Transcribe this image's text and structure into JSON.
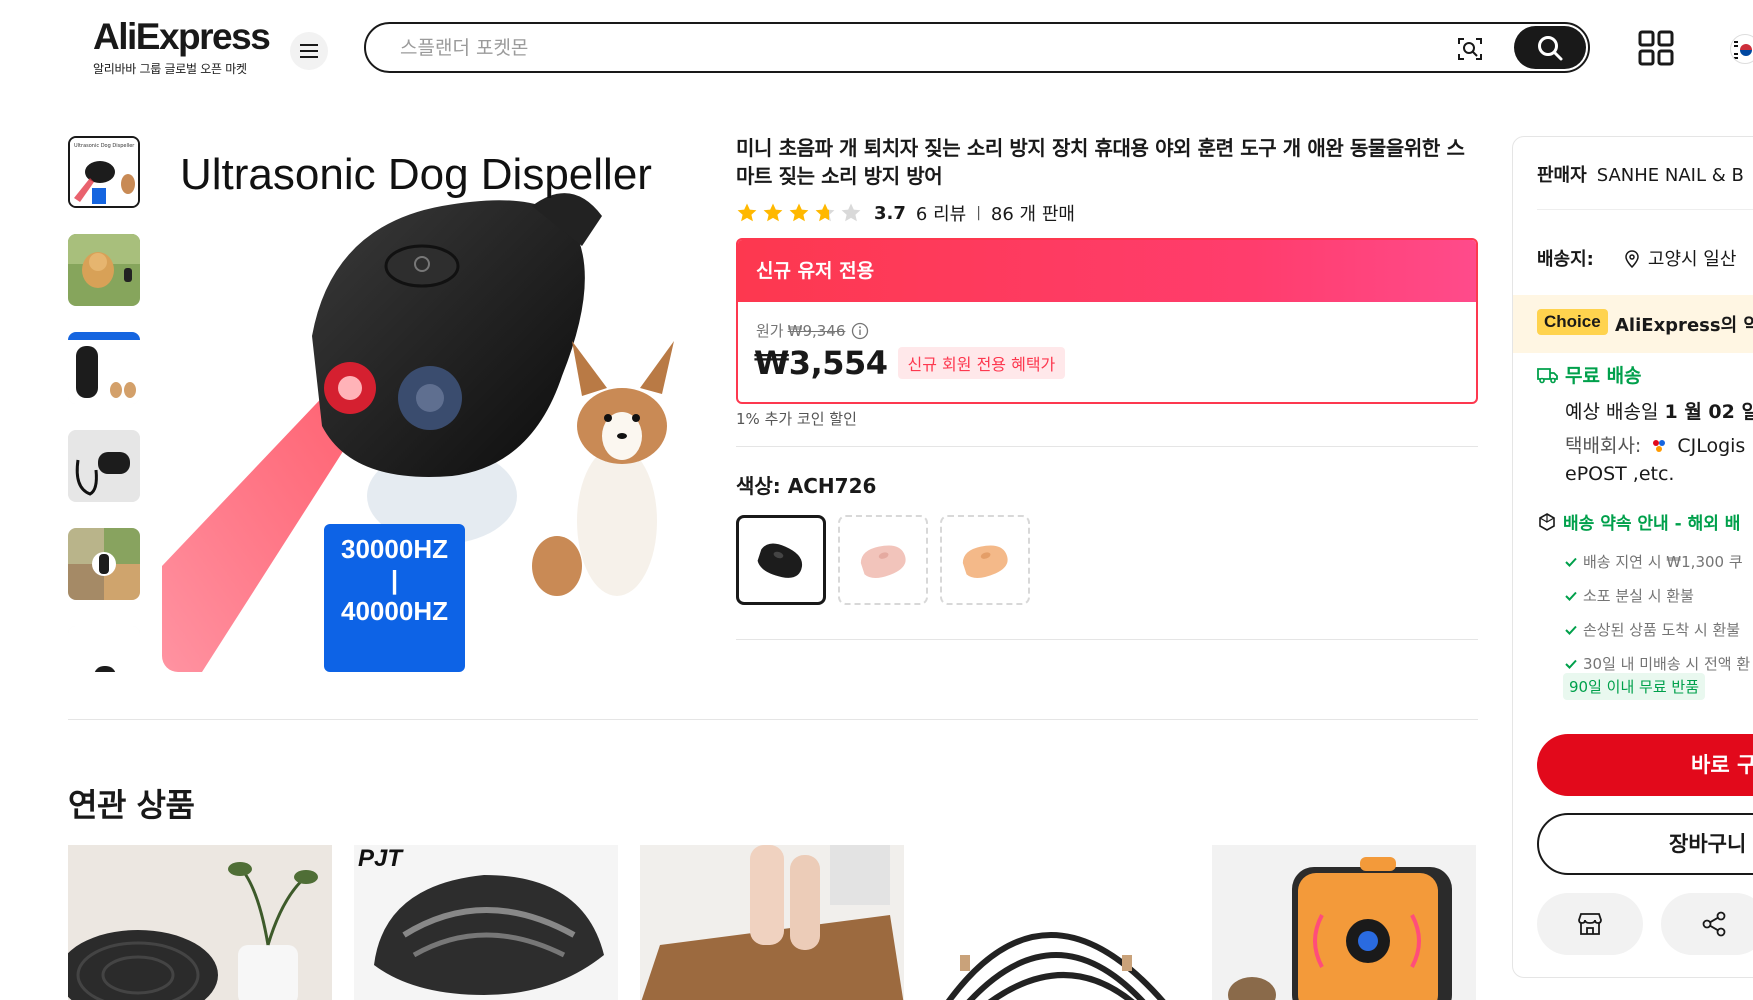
{
  "header": {
    "logo_text": "AliExpress",
    "logo_subtitle": "알리바바 그룹 글로벌 오픈 마켓",
    "search_placeholder": "스플랜더 포켓몬"
  },
  "gallery": {
    "thumbnail_count": 6,
    "main_image_title": "Ultrasonic Dog Dispeller",
    "main_image_freq_top": "30000HZ",
    "main_image_freq_mid": "|",
    "main_image_freq_bottom": "40000HZ"
  },
  "product": {
    "title": "미니 초음파 개 퇴치자 짖는 소리 방지 장치 휴대용 야외 훈련 도구 개 애완 동물을위한 스마트 짖는 소리 방지 방어",
    "rating": "3.7",
    "rating_stars": 3.7,
    "reviews": "6 리뷰",
    "sold": "86 개 판매",
    "promo_header": "신규 유저 전용",
    "original_price_label": "원가",
    "original_price": "₩9,346",
    "price": "₩3,554",
    "promo_tag": "신규 회원 전용 혜택가",
    "coin_note": "1% 추가 코인 할인",
    "color_label": "색상: ACH726",
    "swatches": [
      {
        "name": "black",
        "color": "#1c1c1c"
      },
      {
        "name": "pink",
        "color": "#f2c4bb"
      },
      {
        "name": "peach",
        "color": "#f4b989"
      }
    ]
  },
  "related": {
    "title": "연관 상품",
    "card2_brand": "PJT"
  },
  "sidebar": {
    "seller_label": "판매자",
    "seller_name": "SANHE NAIL & B",
    "ship_to_label": "배송지:",
    "ship_to_value": "고양시 일산",
    "choice_badge": "Choice",
    "choice_text": "AliExpress의 약",
    "free_shipping": "무료 배송",
    "delivery_label": "예상 배송일",
    "delivery_date": "1 월 02 일",
    "courier_label": "택배회사:",
    "courier_name": "CJLogis",
    "courier_more": "ePOST ,etc.",
    "promise_title": "배송 약속 안내 - 해외 배",
    "promise_items": [
      "배송 지연 시 ₩1,300 쿠",
      "소포 분실 시 환불",
      "손상된 상품 도착 시 환불",
      "30일 내 미배송 시 전액 환"
    ],
    "return_badge": "90일 이내 무료 반품",
    "buy_now": "바로 구",
    "add_to_cart": "장바구니"
  },
  "colors": {
    "accent_red": "#fd384f",
    "buy_red": "#e2091b",
    "green": "#00a04b",
    "star": "#ffb800",
    "dark": "#191919"
  }
}
